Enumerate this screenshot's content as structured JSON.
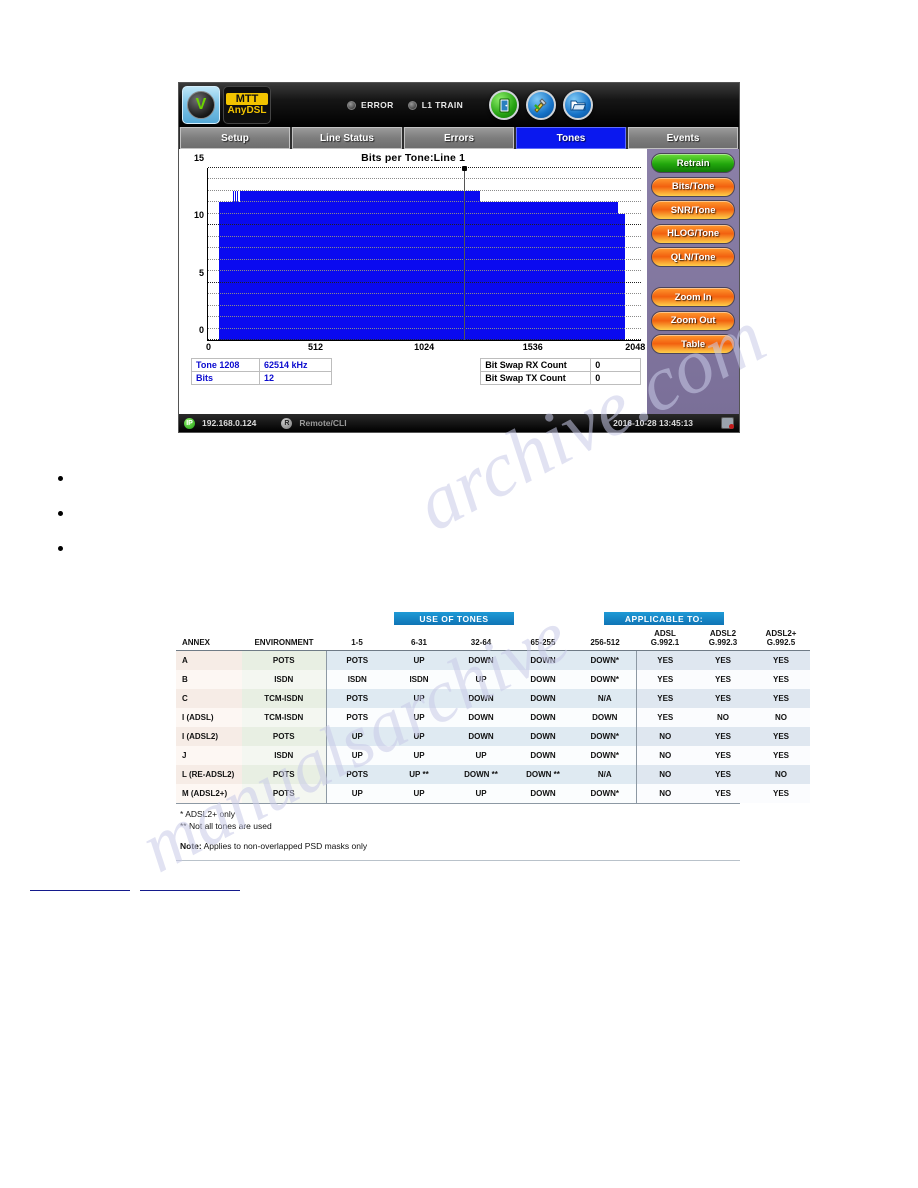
{
  "device": {
    "logo": {
      "mark": "V",
      "badge_top": "MTT",
      "badge_bottom": "AnyDSL"
    },
    "indicators": [
      {
        "name": "error",
        "label": "ERROR"
      },
      {
        "name": "l1-train",
        "label": "L1 TRAIN"
      }
    ],
    "tool_icons": [
      {
        "name": "exit-door-icon",
        "glyph": "▮"
      },
      {
        "name": "tools-icon",
        "glyph": "✔"
      },
      {
        "name": "folder-open-icon",
        "glyph": "▱"
      }
    ],
    "tabs": [
      {
        "label": "Setup",
        "active": false
      },
      {
        "label": "Line Status",
        "active": false
      },
      {
        "label": "Errors",
        "active": false
      },
      {
        "label": "Tones",
        "active": true
      },
      {
        "label": "Events",
        "active": false
      }
    ],
    "side_buttons": [
      {
        "label": "Retrain",
        "color": "green"
      },
      {
        "label": "Bits/Tone",
        "color": "orange"
      },
      {
        "label": "SNR/Tone",
        "color": "orange"
      },
      {
        "label": "HLOG/Tone",
        "color": "orange"
      },
      {
        "label": "QLN/Tone",
        "color": "orange"
      },
      {
        "label": "Zoom In",
        "color": "orange"
      },
      {
        "label": "Zoom Out",
        "color": "orange"
      },
      {
        "label": "Table",
        "color": "orange"
      }
    ],
    "readout": {
      "tone_label": "Tone 1208",
      "tone_freq": "62514 kHz",
      "bits_label": "Bits",
      "bits_value": "12"
    },
    "bitswap": {
      "rx_label": "Bit Swap RX Count",
      "rx_value": "0",
      "tx_label": "Bit Swap TX Count",
      "tx_value": "0"
    },
    "statusbar": {
      "ip_badge": "IP",
      "ip": "192.168.0.124",
      "mode_badge": "R",
      "mode": "Remote/CLI",
      "datetime": "2016-10-28  13:45:13"
    },
    "colors": {
      "bar": "#0a0af0",
      "active_tab": "#0a18ef",
      "retrain": "#22a80d",
      "action": "#f2600f"
    }
  },
  "chart_data": {
    "type": "bar",
    "title": "Bits per Tone:Line 1",
    "xlabel": "",
    "ylabel": "",
    "xlim": [
      0,
      2048
    ],
    "ylim": [
      0,
      15
    ],
    "xticks": [
      "0",
      "512",
      "1024",
      "1536",
      "2048"
    ],
    "yticks": [
      "0",
      "5",
      "10",
      "15"
    ],
    "grid": true,
    "legend": null,
    "cursor": {
      "tone": 1208,
      "bits": 12,
      "freq_khz": 62514
    },
    "segments": [
      {
        "x_start": 32,
        "x_end": 52,
        "value": 0
      },
      {
        "x_start": 52,
        "x_end": 118,
        "value": 12
      },
      {
        "x_start": 118,
        "x_end": 124,
        "value": 13
      },
      {
        "x_start": 124,
        "x_end": 128,
        "value": 12
      },
      {
        "x_start": 128,
        "x_end": 134,
        "value": 13
      },
      {
        "x_start": 134,
        "x_end": 138,
        "value": 12
      },
      {
        "x_start": 138,
        "x_end": 144,
        "value": 13
      },
      {
        "x_start": 144,
        "x_end": 149,
        "value": 12
      },
      {
        "x_start": 149,
        "x_end": 1284,
        "value": 13
      },
      {
        "x_start": 1284,
        "x_end": 1940,
        "value": 12
      },
      {
        "x_start": 1940,
        "x_end": 1972,
        "value": 11
      }
    ]
  },
  "bullets": [
    {
      "text": ""
    },
    {
      "text": ""
    },
    {
      "text": ""
    }
  ],
  "figure": {
    "banners": {
      "use_of_tones": "USE OF TONES",
      "applicable_to": "APPLICABLE TO:"
    },
    "headers": [
      "ANNEX",
      "ENVIRONMENT",
      "1-5",
      "6-31",
      "32-64",
      "65-255",
      "256-512",
      "ADSL\nG.992.1",
      "ADSL2\nG.992.3",
      "ADSL2+\nG.992.5"
    ],
    "headers_app": [
      {
        "top": "ADSL",
        "bottom": "G.992.1"
      },
      {
        "top": "ADSL2",
        "bottom": "G.992.3"
      },
      {
        "top": "ADSL2+",
        "bottom": "G.992.5"
      }
    ],
    "rows": [
      {
        "annex": "A",
        "env": "POTS",
        "t1": "POTS",
        "t2": "UP",
        "t3": "DOWN",
        "t4": "DOWN",
        "t5": "DOWN*",
        "a1": "YES",
        "a2": "YES",
        "a3": "YES"
      },
      {
        "annex": "B",
        "env": "ISDN",
        "t1": "ISDN",
        "t2": "ISDN",
        "t3": "UP",
        "t4": "DOWN",
        "t5": "DOWN*",
        "a1": "YES",
        "a2": "YES",
        "a3": "YES"
      },
      {
        "annex": "C",
        "env": "TCM-ISDN",
        "t1": "POTS",
        "t2": "UP",
        "t3": "DOWN",
        "t4": "DOWN",
        "t5": "N/A",
        "a1": "YES",
        "a2": "YES",
        "a3": "YES"
      },
      {
        "annex": "I (ADSL)",
        "env": "TCM-ISDN",
        "t1": "POTS",
        "t2": "UP",
        "t3": "DOWN",
        "t4": "DOWN",
        "t5": "DOWN",
        "a1": "YES",
        "a2": "NO",
        "a3": "NO"
      },
      {
        "annex": "I (ADSL2)",
        "env": "POTS",
        "t1": "UP",
        "t2": "UP",
        "t3": "DOWN",
        "t4": "DOWN",
        "t5": "DOWN*",
        "a1": "NO",
        "a2": "YES",
        "a3": "YES"
      },
      {
        "annex": "J",
        "env": "ISDN",
        "t1": "UP",
        "t2": "UP",
        "t3": "UP",
        "t4": "DOWN",
        "t5": "DOWN*",
        "a1": "NO",
        "a2": "YES",
        "a3": "YES"
      },
      {
        "annex": "L (RE-ADSL2)",
        "env": "POTS",
        "t1": "POTS",
        "t2": "UP **",
        "t3": "DOWN **",
        "t4": "DOWN **",
        "t5": "N/A",
        "a1": "NO",
        "a2": "YES",
        "a3": "NO"
      },
      {
        "annex": "M (ADSL2+)",
        "env": "POTS",
        "t1": "UP",
        "t2": "UP",
        "t3": "UP",
        "t4": "DOWN",
        "t5": "DOWN*",
        "a1": "NO",
        "a2": "YES",
        "a3": "YES"
      }
    ],
    "footnotes": [
      "* ADSL2+ only",
      "** Not all tones are used"
    ],
    "note_label": "Note:",
    "note_text": "Applies to non-overlapped PSD masks only"
  },
  "watermark": {
    "line1": "archive.com",
    "line2": "manualsarchive"
  },
  "links": [
    {
      "label": ""
    },
    {
      "label": ""
    }
  ]
}
